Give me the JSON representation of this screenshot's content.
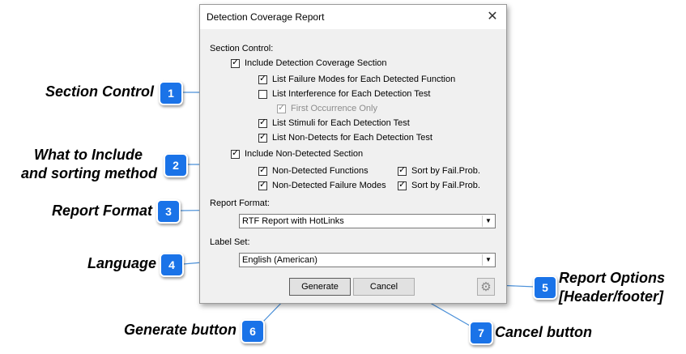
{
  "dialog": {
    "title": "Detection Coverage Report",
    "close_icon": "close-icon",
    "section_control_label": "Section Control:",
    "include_detection": "Include Detection Coverage Section",
    "list_failure_modes": "List Failure Modes for Each Detected Function",
    "list_interference": "List Interference for Each Detection Test",
    "first_occurrence": "First Occurrence Only",
    "list_stimuli": "List Stimuli for Each Detection Test",
    "list_non_detects": "List Non-Detects for Each Detection Test",
    "include_non_detected": "Include Non-Detected Section",
    "non_detected_functions": "Non-Detected Functions",
    "non_detected_failure_modes": "Non-Detected Failure Modes",
    "sort_by_1": "Sort by Fail.Prob.",
    "sort_by_2": "Sort by Fail.Prob.",
    "report_format_label": "Report Format:",
    "report_format_value": "RTF Report with HotLinks",
    "label_set_label": "Label Set:",
    "label_set_value": "English (American)",
    "generate": "Generate",
    "cancel": "Cancel",
    "options_icon": "gear-icon"
  },
  "callouts": {
    "c1": "Section Control",
    "c2_line1": "What to Include",
    "c2_line2": "and sorting method",
    "c3": "Report Format",
    "c4": "Language",
    "c5_line1": "Report Options",
    "c5_line2": "[Header/footer]",
    "c6": "Generate button",
    "c7": "Cancel button"
  },
  "badges": {
    "b1": "1",
    "b2": "2",
    "b3": "3",
    "b4": "4",
    "b5": "5",
    "b6": "6",
    "b7": "7"
  },
  "colors": {
    "badge": "#1a73e8",
    "leader_line": "#4a90d9"
  }
}
